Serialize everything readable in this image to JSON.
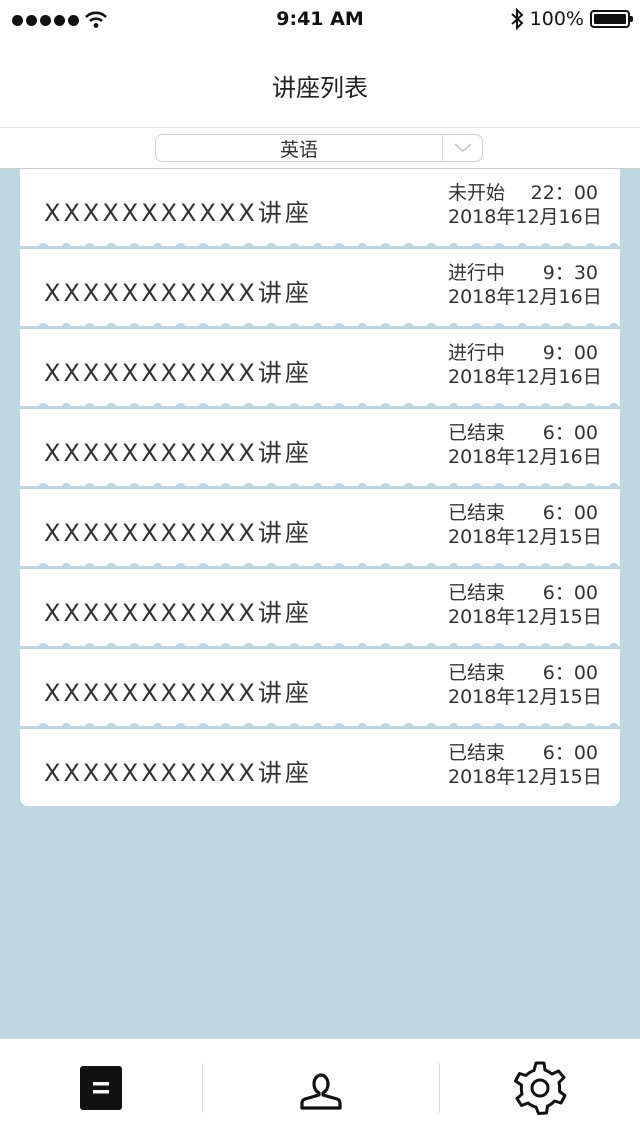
{
  "status_bar": {
    "time": "9:41 AM",
    "battery": "100%",
    "icons": [
      "signal-icon",
      "wifi-icon",
      "bluetooth-icon",
      "battery-icon"
    ]
  },
  "nav": {
    "title": "讲座列表"
  },
  "filter": {
    "selected": "英语",
    "icon": "chevron-down-icon"
  },
  "lectures": [
    {
      "title": "XXXXXXXXXXX讲座",
      "status": "未开始",
      "time": "22：00",
      "date": "2018年12月16日"
    },
    {
      "title": "XXXXXXXXXXX讲座",
      "status": "进行中",
      "time": "9：30",
      "date": "2018年12月16日"
    },
    {
      "title": "XXXXXXXXXXX讲座",
      "status": "进行中",
      "time": "9：00",
      "date": "2018年12月16日"
    },
    {
      "title": "XXXXXXXXXXX讲座",
      "status": "已结束",
      "time": "6：00",
      "date": "2018年12月16日"
    },
    {
      "title": "XXXXXXXXXXX讲座",
      "status": "已结束",
      "time": "6：00",
      "date": "2018年12月15日"
    },
    {
      "title": "XXXXXXXXXXX讲座",
      "status": "已结束",
      "time": "6：00",
      "date": "2018年12月15日"
    },
    {
      "title": "XXXXXXXXXXX讲座",
      "status": "已结束",
      "time": "6：00",
      "date": "2018年12月15日"
    },
    {
      "title": "XXXXXXXXXXX讲座",
      "status": "已结束",
      "time": "6：00",
      "date": "2018年12月15日"
    }
  ],
  "tab_bar": {
    "items": [
      {
        "icon": "document-icon",
        "active": true
      },
      {
        "icon": "user-icon",
        "active": false
      },
      {
        "icon": "gear-icon",
        "active": false
      }
    ]
  },
  "colors": {
    "background": "#bfd7e3",
    "card": "#ffffff",
    "text": "#333333"
  }
}
